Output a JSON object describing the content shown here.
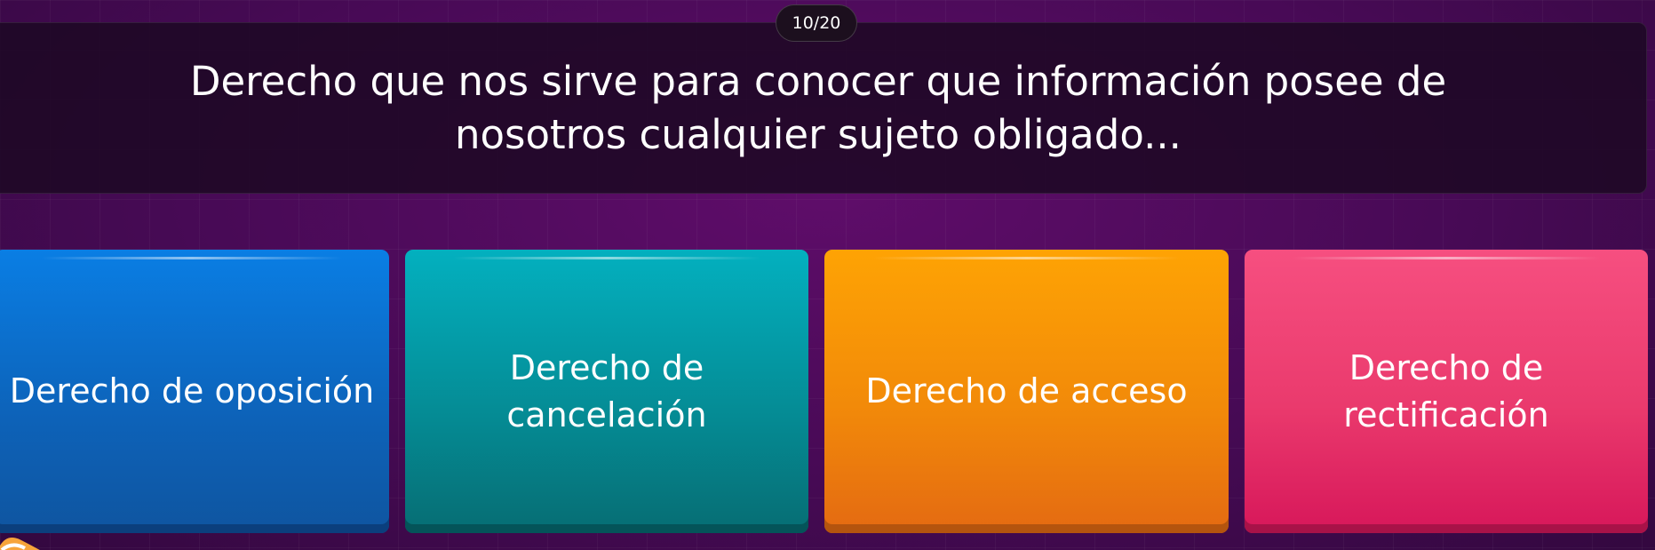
{
  "quiz": {
    "progress": "10/20",
    "question": "Derecho que nos sirve para conocer que información posee de nosotros cualquier sujeto obligado...",
    "options": [
      {
        "label": "Derecho de oposición",
        "color": "#0a7ee4"
      },
      {
        "label": "Derecho de cancelación",
        "color": "#03b0bf"
      },
      {
        "label": "Derecho de acceso",
        "color": "#fea304"
      },
      {
        "label": "Derecho de rectificación",
        "color": "#f64f80"
      }
    ]
  },
  "theme": {
    "background": "#4b0a58",
    "question_bg": "#1e0824"
  }
}
